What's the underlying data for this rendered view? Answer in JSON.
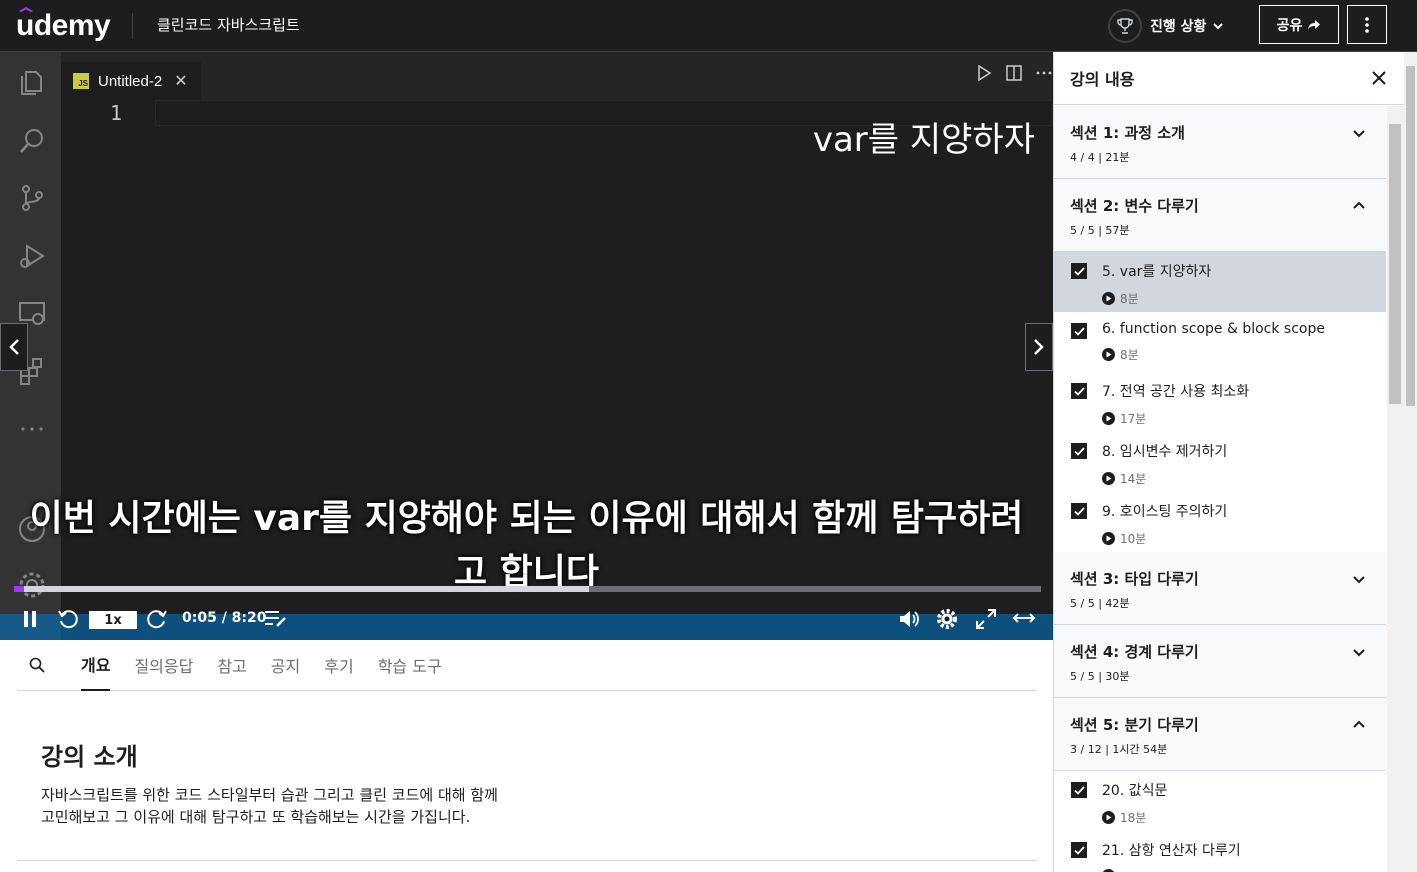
{
  "header": {
    "logo": "udemy",
    "course_title": "클린코드 자바스크립트",
    "progress_label": "진행 상황",
    "share_label": "공유"
  },
  "video": {
    "editor_tab": "Untitled-2",
    "js_badge": "JS",
    "line_number": "1",
    "chapter_overlay": "var를 지양하자",
    "subtitle": "이번 시간에는 var를 지양해야 되는 이유에 대해서 함께 탐구하려고 합니다",
    "playback_rate": "1x",
    "time": "0:05 / 8:20",
    "played_fraction": 0.01,
    "buffered_fraction": 0.56
  },
  "tabs": [
    "개요",
    "질의응답",
    "참고",
    "공지",
    "후기",
    "학습 도구"
  ],
  "active_tab": "개요",
  "overview": {
    "title": "강의 소개",
    "description_line1": "자바스크립트를 위한 코드 스타일부터 습관 그리고 클린 코드에 대해 함께",
    "description_line2": "고민해보고 그 이유에 대해 탐구하고 또 학습해보는 시간을 가집니다."
  },
  "sidebar": {
    "title": "강의 내용",
    "sections": [
      {
        "title": "섹션 1: 과정 소개",
        "meta": "4 / 4 | 21분",
        "expanded": false,
        "lectures": []
      },
      {
        "title": "섹션 2: 변수 다루기",
        "meta": "5 / 5 | 57분",
        "expanded": true,
        "lectures": [
          {
            "title": "5. var를 지양하자",
            "duration": "8분",
            "completed": true,
            "current": true
          },
          {
            "title": "6. function scope & block scope",
            "duration": "8분",
            "completed": true,
            "current": false
          },
          {
            "title": "7. 전역 공간 사용 최소화",
            "duration": "17분",
            "completed": true,
            "current": false
          },
          {
            "title": "8. 임시변수 제거하기",
            "duration": "14분",
            "completed": true,
            "current": false
          },
          {
            "title": "9. 호이스팅 주의하기",
            "duration": "10분",
            "completed": true,
            "current": false
          }
        ]
      },
      {
        "title": "섹션 3: 타입 다루기",
        "meta": "5 / 5 | 42분",
        "expanded": false,
        "lectures": []
      },
      {
        "title": "섹션 4: 경계 다루기",
        "meta": "5 / 5 | 30분",
        "expanded": false,
        "lectures": []
      },
      {
        "title": "섹션 5: 분기 다루기",
        "meta": "3 / 12 | 1시간 54분",
        "expanded": true,
        "lectures": [
          {
            "title": "20. 값식문",
            "duration": "18분",
            "completed": true,
            "current": false
          },
          {
            "title": "21. 삼항 연산자 다루기",
            "duration": "",
            "completed": true,
            "current": false
          }
        ]
      }
    ]
  },
  "colors": {
    "brand_purple": "#a435f0",
    "header_bg": "#1c1d1f",
    "vscode_blue": "#007acc"
  }
}
